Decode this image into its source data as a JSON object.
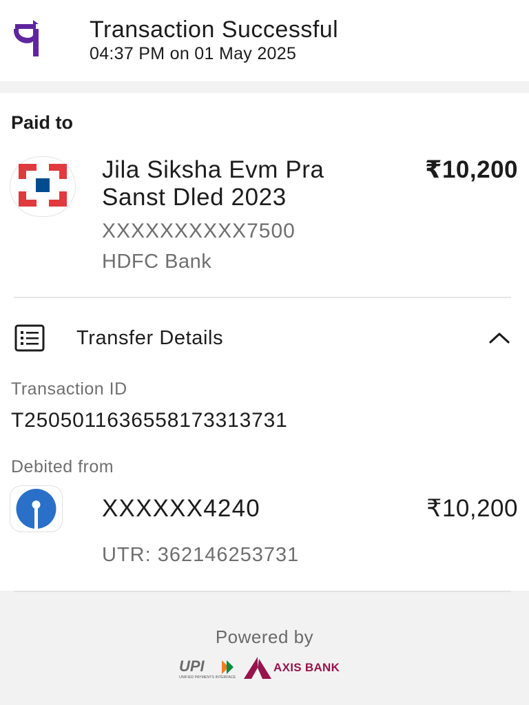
{
  "header": {
    "title": "Transaction Successful",
    "datetime": "04:37 PM on 01 May 2025",
    "logo_icon": "phonepe-logo",
    "logo_color": "#5f259f"
  },
  "paid_to": {
    "label": "Paid to",
    "name": "Jila Siksha Evm Pra Sanst Dled 2023",
    "amount": "₹10,200",
    "account": "XXXXXXXXXX7500",
    "bank": "HDFC Bank",
    "bank_icon": "hdfc-bank-logo",
    "bank_colors": {
      "red": "#e03a3e",
      "blue": "#004c8f"
    }
  },
  "transfer_details": {
    "title": "Transfer Details",
    "icon": "list-details-icon",
    "toggle_icon": "chevron-up-icon",
    "transaction_id_label": "Transaction ID",
    "transaction_id": "T2505011636558173313731",
    "debited_from_label": "Debited from",
    "debit_account": "XXXXXX4240",
    "debit_amount": "₹10,200",
    "utr": "UTR: 362146253731",
    "debit_bank_icon": "sbi-logo",
    "debit_bank_color": "#2a70c8"
  },
  "footer": {
    "powered_by": "Powered by",
    "upi_logo_text": "UPI",
    "upi_tagline": "UNIFIED PAYMENTS INTERFACE",
    "partner_bank": "AXIS BANK",
    "partner_color": "#97144d"
  }
}
